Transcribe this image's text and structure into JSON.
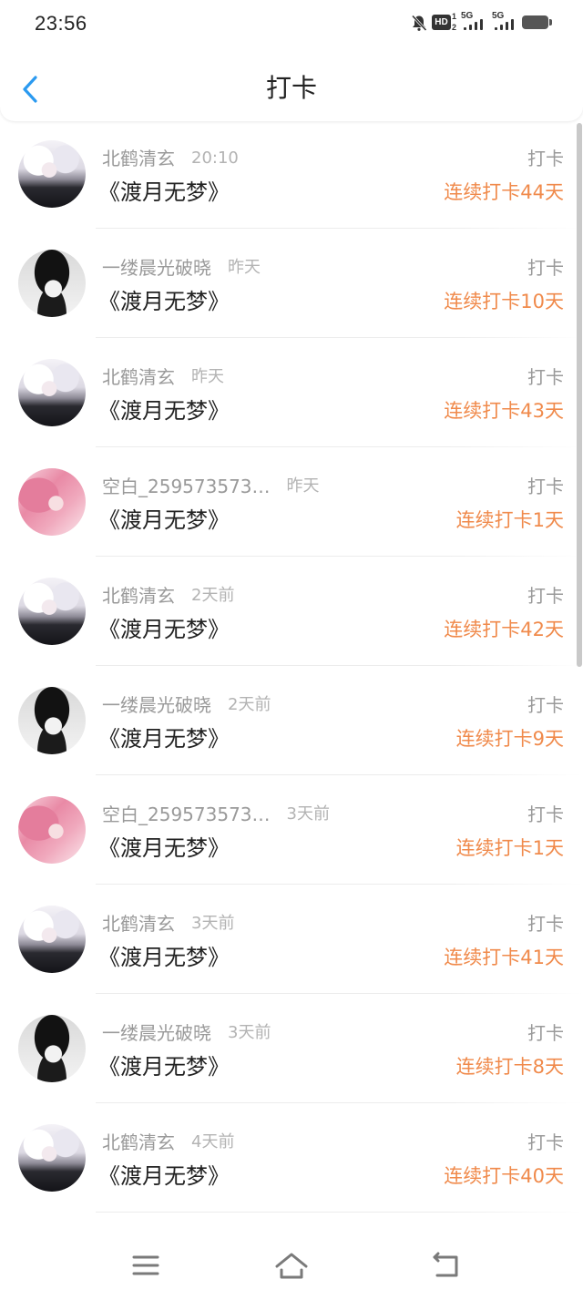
{
  "status_bar": {
    "time": "23:56",
    "hd_label": "HD",
    "hd_sim_1": "1",
    "hd_sim_2": "2",
    "network_1": "5G",
    "network_2": "5G",
    "icons": [
      "bell-mute-icon",
      "hd-voice-icon",
      "signal-icon",
      "signal-icon",
      "battery-icon"
    ]
  },
  "header": {
    "title": "打卡",
    "back_icon": "chevron-left-icon"
  },
  "colors": {
    "accent": "#2b9af0",
    "streak": "#f08a4b",
    "secondary_text": "#9a9a9a",
    "primary_text": "#222222"
  },
  "checkins": [
    {
      "user": "北鹤清玄",
      "time": "20:10",
      "book": "《渡月无梦》",
      "action": "打卡",
      "streak": "连续打卡44天",
      "avatar_icon": "white-hair-avatar-icon"
    },
    {
      "user": "一缕晨光破晓",
      "time": "昨天",
      "book": "《渡月无梦》",
      "action": "打卡",
      "streak": "连续打卡10天",
      "avatar_icon": "dark-hair-avatar-icon"
    },
    {
      "user": "北鹤清玄",
      "time": "昨天",
      "book": "《渡月无梦》",
      "action": "打卡",
      "streak": "连续打卡43天",
      "avatar_icon": "white-hair-avatar-icon"
    },
    {
      "user": "空白_259573573…",
      "time": "昨天",
      "book": "《渡月无梦》",
      "action": "打卡",
      "streak": "连续打卡1天",
      "avatar_icon": "pink-hair-avatar-icon"
    },
    {
      "user": "北鹤清玄",
      "time": "2天前",
      "book": "《渡月无梦》",
      "action": "打卡",
      "streak": "连续打卡42天",
      "avatar_icon": "white-hair-avatar-icon"
    },
    {
      "user": "一缕晨光破晓",
      "time": "2天前",
      "book": "《渡月无梦》",
      "action": "打卡",
      "streak": "连续打卡9天",
      "avatar_icon": "dark-hair-avatar-icon"
    },
    {
      "user": "空白_259573573…",
      "time": "3天前",
      "book": "《渡月无梦》",
      "action": "打卡",
      "streak": "连续打卡1天",
      "avatar_icon": "pink-hair-avatar-icon"
    },
    {
      "user": "北鹤清玄",
      "time": "3天前",
      "book": "《渡月无梦》",
      "action": "打卡",
      "streak": "连续打卡41天",
      "avatar_icon": "white-hair-avatar-icon"
    },
    {
      "user": "一缕晨光破晓",
      "time": "3天前",
      "book": "《渡月无梦》",
      "action": "打卡",
      "streak": "连续打卡8天",
      "avatar_icon": "dark-hair-avatar-icon"
    },
    {
      "user": "北鹤清玄",
      "time": "4天前",
      "book": "《渡月无梦》",
      "action": "打卡",
      "streak": "连续打卡40天",
      "avatar_icon": "white-hair-avatar-icon"
    }
  ],
  "nav_bar": {
    "icons": [
      "menu-icon",
      "home-icon",
      "back-icon"
    ]
  }
}
